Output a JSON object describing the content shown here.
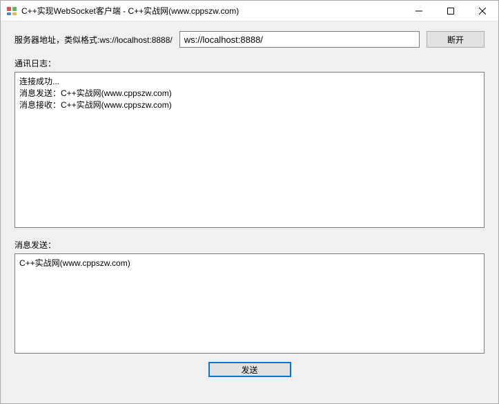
{
  "window": {
    "title": "C++实现WebSocket客户端 - C++实战网(www.cppszw.com)"
  },
  "address": {
    "label": "服务器地址，类似格式:ws://localhost:8888/",
    "value": "ws://localhost:8888/"
  },
  "buttons": {
    "disconnect": "断开",
    "send": "发送"
  },
  "log": {
    "label": "通讯日志：",
    "content": "连接成功...\n消息发送：C++实战网(www.cppszw.com)\n消息接收：C++实战网(www.cppszw.com)"
  },
  "send": {
    "label": "消息发送：",
    "content": "C++实战网(www.cppszw.com)"
  }
}
